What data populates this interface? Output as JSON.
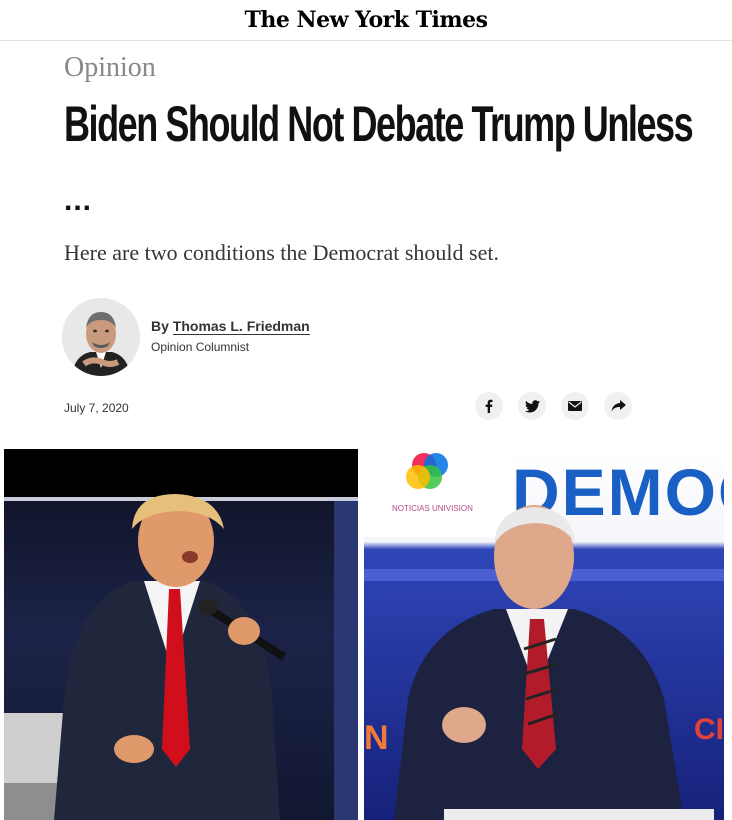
{
  "masthead": {
    "title": "The New York Times"
  },
  "article": {
    "section": "Opinion",
    "headline": "Biden Should Not Debate Trump Unless",
    "headline_continuation": "...",
    "summary": "Here are two conditions the Democrat should set.",
    "byline_prefix": "By",
    "author": "Thomas L. Friedman",
    "author_role": "Opinion Columnist",
    "date": "July 7, 2020"
  },
  "share_icons": [
    "facebook-icon",
    "twitter-icon",
    "email-icon",
    "share-icon"
  ],
  "images": {
    "right_backdrop_text": "DEMOC",
    "right_logo_text": "NOTICIAS UNIVISION",
    "right_edge_text": "N",
    "right_edge_text_2": "CI"
  },
  "colors": {
    "text": "#121212",
    "kicker": "#888888",
    "share_bg": "#f0f0f0",
    "tie_red": "#d10f1c",
    "debate_blue": "#1e40a0"
  }
}
